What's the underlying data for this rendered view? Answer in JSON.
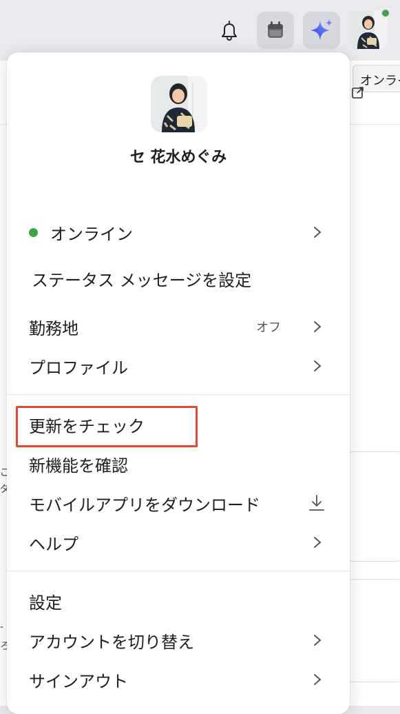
{
  "topbar": {
    "bell_icon": "bell-icon",
    "calendar_icon": "calendar-icon",
    "ai_icon": "sparkle-icon",
    "tooltip": "オンライン"
  },
  "profile": {
    "name": "セ 花水めぐみ",
    "status_color": "#3fa345"
  },
  "menu": {
    "online": "オンライン",
    "status_message": "ステータス メッセージを設定",
    "workplace": "勤務地",
    "workplace_value": "オフ",
    "profile": "プロファイル",
    "check_updates": "更新をチェック",
    "whats_new": "新機能を確認",
    "download_mobile": "モバイルアプリをダウンロード",
    "help": "ヘルプ",
    "settings": "設定",
    "switch_account": "アカウントを切り替え",
    "sign_out": "サインアウト"
  },
  "background": {
    "edge_text_1": "ご",
    "edge_text_2": "ダ",
    "edge_text_3": "-",
    "edge_text_4": "ろ"
  },
  "colors": {
    "accent_highlight": "#e8462f",
    "online_green": "#3fa345"
  }
}
